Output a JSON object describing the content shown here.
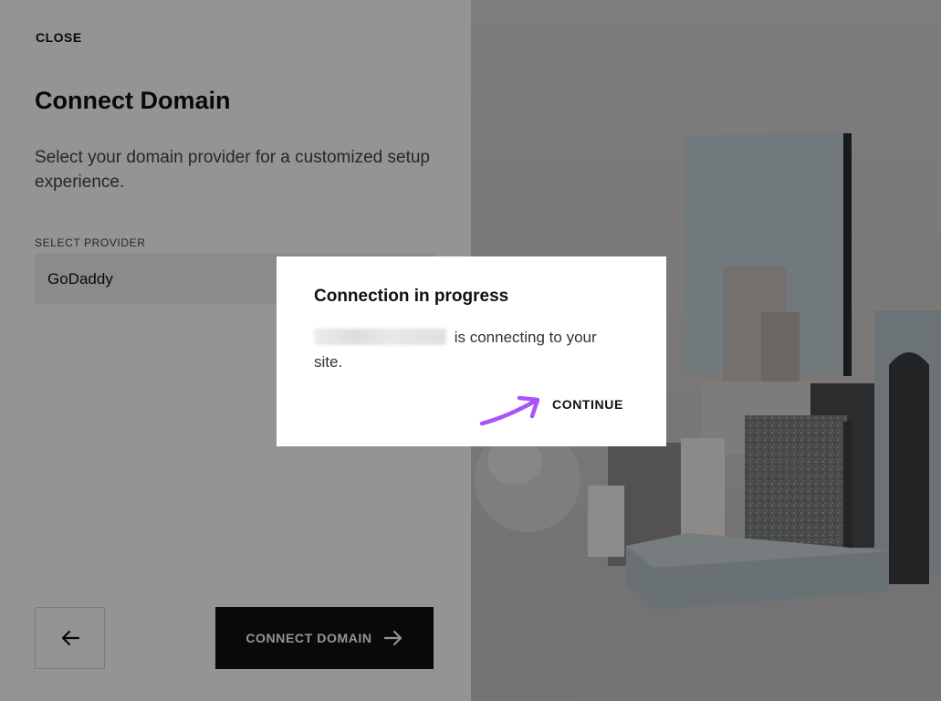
{
  "left_panel": {
    "close_label": "CLOSE",
    "title": "Connect Domain",
    "subtitle": "Select your domain provider for a customized setup experience.",
    "field_label": "SELECT PROVIDER",
    "provider_value": "GoDaddy",
    "connect_button_label": "CONNECT DOMAIN"
  },
  "icons": {
    "back": "arrow-left-icon",
    "connect": "arrow-right-icon",
    "pointer": "pointer-arrow-icon"
  },
  "modal": {
    "title": "Connection in progress",
    "body_text": " is connecting to your site.",
    "continue_label": "CONTINUE"
  },
  "colors": {
    "primary_button": "#111111",
    "pointer_arrow": "#a855f7",
    "overlay": "rgba(0,0,0,0.42)"
  }
}
